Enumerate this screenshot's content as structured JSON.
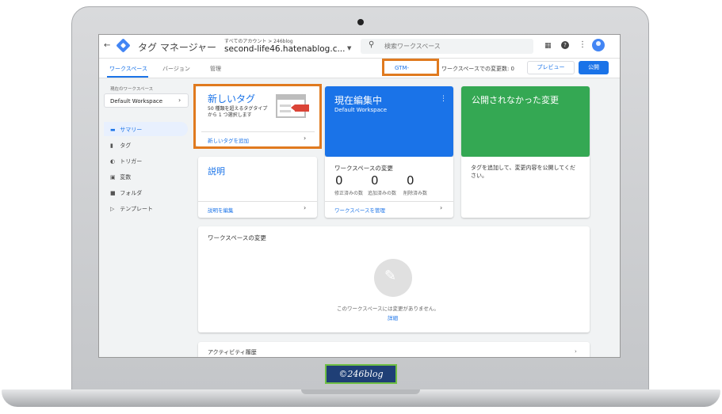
{
  "header": {
    "back_icon": "arrow-left-icon",
    "product": "タグ マネージャー",
    "account_path": "すべてのアカウント > 246blog",
    "container": "second-life46.hatenablog.c...",
    "search_placeholder": "検索ワークスペース"
  },
  "tabs": [
    {
      "label": "ワークスペース",
      "active": true
    },
    {
      "label": "バージョン",
      "active": false
    },
    {
      "label": "管理",
      "active": false
    }
  ],
  "toolbar": {
    "gtm_id": "GTM-",
    "workspace_changes": "ワークスペースでの変更数: 0",
    "preview": "プレビュー",
    "publish": "公開"
  },
  "sidebar": {
    "workspace_label": "現在のワークスペース",
    "workspace_name": "Default Workspace",
    "items": [
      {
        "label": "サマリー",
        "icon": "summary-icon",
        "active": true
      },
      {
        "label": "タグ",
        "icon": "tag-icon",
        "active": false
      },
      {
        "label": "トリガー",
        "icon": "trigger-icon",
        "active": false
      },
      {
        "label": "変数",
        "icon": "variable-icon",
        "active": false
      },
      {
        "label": "フォルダ",
        "icon": "folder-icon",
        "active": false
      },
      {
        "label": "テンプレート",
        "icon": "template-icon",
        "active": false
      }
    ]
  },
  "cards": {
    "new_tag": {
      "title": "新しいタグ",
      "description": "50 種類を超えるタグタイプから 1 つ選択します",
      "link": "新しいタグを追加"
    },
    "current": {
      "title": "現在編集中",
      "subtitle": "Default Workspace"
    },
    "unpublished": {
      "title": "公開されなかった変更",
      "description": "タグを追加して、変更内容を公開してください。"
    },
    "description": {
      "title": "説明",
      "link": "説明を編集"
    },
    "workspace_changes": {
      "title": "ワークスペースの変更",
      "stats": [
        {
          "value": "0",
          "label": "修正済みの数"
        },
        {
          "value": "0",
          "label": "追加済みの数"
        },
        {
          "value": "0",
          "label": "削除済み数"
        }
      ],
      "link": "ワークスペースを管理"
    },
    "changes_list": {
      "title": "ワークスペースの変更",
      "empty_text": "このワークスペースには変更がありません。",
      "detail_link": "詳細"
    },
    "activity": {
      "title": "アクティビティ履歴"
    }
  },
  "watermark": "©246blog",
  "colors": {
    "primary": "#1a73e8",
    "current_card": "#1a73e8",
    "unpublished_card": "#34a853",
    "highlight": "#e07a1f"
  }
}
